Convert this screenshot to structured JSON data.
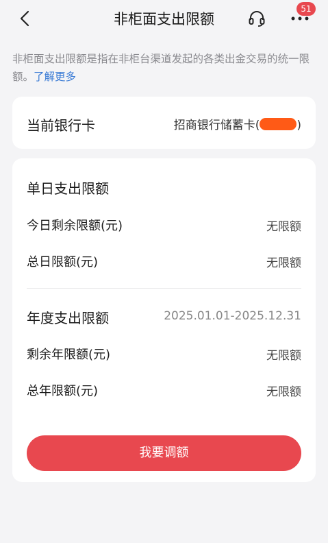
{
  "header": {
    "title": "非柜面支出限额",
    "badge_count": "51",
    "icons": {
      "back": "chevron-left-icon",
      "service": "headset-icon",
      "more": "more-dots-icon"
    }
  },
  "description": {
    "text": "非柜面支出限额是指在非柜台渠道发起的各类出金交易的统一限额。",
    "link": "了解更多"
  },
  "current_card": {
    "label": "当前银行卡",
    "value_prefix": "招商银行储蓄卡(",
    "value_suffix": ")"
  },
  "daily": {
    "title": "单日支出限额",
    "rows": [
      {
        "label": "今日剩余限额(元)",
        "value": "无限额"
      },
      {
        "label": "总日限额(元)",
        "value": "无限额"
      }
    ]
  },
  "annual": {
    "title": "年度支出限额",
    "period": "2025.01.01-2025.12.31",
    "rows": [
      {
        "label": "剩余年限额(元)",
        "value": "无限额"
      },
      {
        "label": "总年限额(元)",
        "value": "无限额"
      }
    ]
  },
  "actions": {
    "adjust_label": "我要调额"
  },
  "colors": {
    "accent": "#e8484f",
    "link": "#3a7bd5",
    "mask": "#ff5a16"
  }
}
